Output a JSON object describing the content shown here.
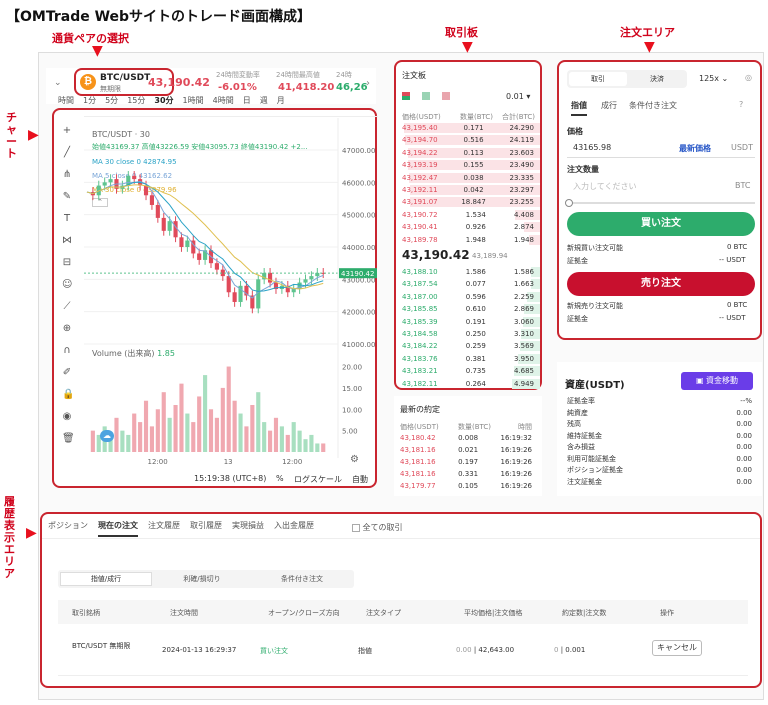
{
  "title": "【OMTrade Webサイトのトレード画面構成】",
  "annotations": {
    "pair": "通貨ペアの選択",
    "orderbook": "取引板",
    "order": "注文エリア",
    "chart": "チャート",
    "history": "履歴表示エリア"
  },
  "header": {
    "pair": "BTC/USDT",
    "pair_sub": "無期限",
    "price": "43,190.42",
    "stats": [
      {
        "label": "24時間変動率",
        "value": "-6.01%"
      },
      {
        "label": "24時間最高値",
        "value": "41,418.20"
      },
      {
        "label": "24時",
        "value": "46,26"
      }
    ]
  },
  "timeframes": [
    "時間",
    "1分",
    "5分",
    "15分",
    "30分",
    "1時間",
    "4時間",
    "日",
    "週",
    "月"
  ],
  "chart": {
    "symbol": "BTC/USDT · 30",
    "ohlc": "始値43169.37 高値43226.59 安値43095.73 終値43190.42 +2...",
    "ma1": "MA 30 close 0  42874.95",
    "ma2": "MA 5 close 0  43162.62",
    "ma3": "MA 30 close 0  43079.96",
    "yticks": [
      "47000.00",
      "46000.00",
      "45000.00",
      "44000.00",
      "43000.00",
      "42000.00",
      "41000.00"
    ],
    "last_price": "43190.42",
    "volume_label": "Volume (出来高)",
    "volume_value": "1.85",
    "vticks": [
      "20.00",
      "15.00",
      "10.00",
      "5.00"
    ],
    "xticks": [
      "12:00",
      "13",
      "12:00"
    ],
    "footer_time": "15:19:38 (UTC+8)",
    "footer_pct": "%",
    "footer_log": "ログスケール",
    "footer_auto": "自動"
  },
  "orderbook": {
    "title": "注文板",
    "precision": "0.01",
    "headers": [
      "価格(USDT)",
      "数量(BTC)",
      "合計(BTC)"
    ],
    "asks": [
      [
        "43,195.40",
        "0.171",
        "24.290"
      ],
      [
        "43,194.70",
        "0.516",
        "24.119"
      ],
      [
        "43,194.22",
        "0.113",
        "23.603"
      ],
      [
        "43,193.19",
        "0.155",
        "23.490"
      ],
      [
        "43,192.47",
        "0.038",
        "23.335"
      ],
      [
        "43,192.11",
        "0.042",
        "23.297"
      ],
      [
        "43,191.07",
        "18.847",
        "23.255"
      ],
      [
        "43,190.72",
        "1.534",
        "4.408"
      ],
      [
        "43,190.41",
        "0.926",
        "2.874"
      ],
      [
        "43,189.78",
        "1.948",
        "1.948"
      ]
    ],
    "mid_price": "43,190.42",
    "mid_sub": "43,189.94",
    "bids": [
      [
        "43,188.10",
        "1.586",
        "1.586"
      ],
      [
        "43,187.54",
        "0.077",
        "1.663"
      ],
      [
        "43,187.00",
        "0.596",
        "2.259"
      ],
      [
        "43,185.85",
        "0.610",
        "2.869"
      ],
      [
        "43,185.39",
        "0.191",
        "3.060"
      ],
      [
        "43,184.58",
        "0.250",
        "3.310"
      ],
      [
        "43,184.22",
        "0.259",
        "3.569"
      ],
      [
        "43,183.76",
        "0.381",
        "3.950"
      ],
      [
        "43,183.21",
        "0.735",
        "4.685"
      ],
      [
        "43,182.11",
        "0.264",
        "4.949"
      ]
    ]
  },
  "trades": {
    "title": "最新の約定",
    "headers": [
      "価格(USDT)",
      "数量(BTC)",
      "時間"
    ],
    "rows": [
      [
        "43,180.42",
        "0.008",
        "16:19:32"
      ],
      [
        "43,181.16",
        "0.021",
        "16:19:26"
      ],
      [
        "43,181.16",
        "0.197",
        "16:19:26"
      ],
      [
        "43,181.16",
        "0.331",
        "16:19:26"
      ],
      [
        "43,179.77",
        "0.105",
        "16:19:26"
      ]
    ]
  },
  "order": {
    "tabs": [
      "取引",
      "決済"
    ],
    "leverage": "125x",
    "types": [
      "指値",
      "成行",
      "条件付き注文"
    ],
    "price_label": "価格",
    "price_value": "43165.98",
    "latest": "最新価格",
    "usdt": "USDT",
    "qty_label": "注文数量",
    "qty_placeholder": "入力してください",
    "btc": "BTC",
    "buy": "買い注文",
    "buy_avail": "新規買い注文可能",
    "buy_avail_val": "0 BTC",
    "margin": "証拠金",
    "margin_val": "-- USDT",
    "sell": "売り注文",
    "sell_avail": "新規売り注文可能",
    "sell_avail_val": "0 BTC"
  },
  "assets": {
    "title": "資産(USDT)",
    "transfer": "資金移動",
    "rows": [
      [
        "証拠金率",
        "--%"
      ],
      [
        "純資産",
        "0.00"
      ],
      [
        "残高",
        "0.00"
      ],
      [
        "維持証拠金",
        "0.00"
      ],
      [
        "含み損益",
        "0.00"
      ],
      [
        "利用可能証拠金",
        "0.00"
      ],
      [
        "ポジション証拠金",
        "0.00"
      ],
      [
        "注文証拠金",
        "0.00"
      ]
    ]
  },
  "history": {
    "tabs": [
      "ポジション",
      "現在の注文",
      "注文履歴",
      "取引履歴",
      "実現損益",
      "入出金履歴"
    ],
    "all": "全ての取引",
    "subtabs": [
      "指値/成行",
      "利確/損切り",
      "条件付き注文"
    ],
    "headers": [
      "取引銘柄",
      "注文時間",
      "オープン/クローズ方向",
      "注文タイプ",
      "平均価格|注文価格",
      "約定数|注文数",
      "操作"
    ],
    "row": {
      "symbol": "BTC/USDT 無期限",
      "time": "2024-01-13 16:29:37",
      "side": "買い注文",
      "type": "指値",
      "price_avg": "0.00",
      "price_order": "42,643.00",
      "qty_filled": "0",
      "qty_order": "0.001",
      "action": "キャンセル"
    }
  },
  "colors": {
    "up": "#2dac6c",
    "down": "#e04a5a",
    "accent": "#c9252f",
    "asset_btn": "#6a3de8"
  }
}
